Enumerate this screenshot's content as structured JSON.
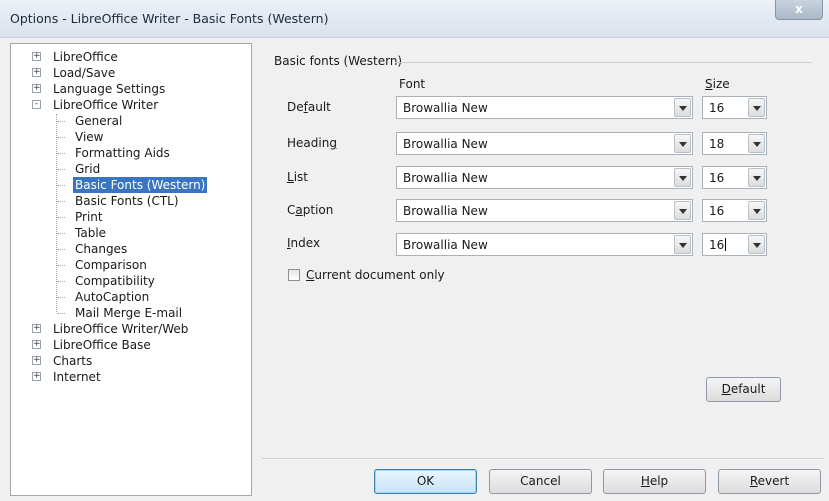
{
  "window": {
    "title": "Options - LibreOffice Writer - Basic Fonts (Western)",
    "close_label": "x"
  },
  "tree": {
    "items": [
      {
        "label": "LibreOffice",
        "level": 0,
        "expander": "+"
      },
      {
        "label": "Load/Save",
        "level": 0,
        "expander": "+"
      },
      {
        "label": "Language Settings",
        "level": 0,
        "expander": "+"
      },
      {
        "label": "LibreOffice Writer",
        "level": 0,
        "expander": "-"
      },
      {
        "label": "General",
        "level": 1
      },
      {
        "label": "View",
        "level": 1
      },
      {
        "label": "Formatting Aids",
        "level": 1
      },
      {
        "label": "Grid",
        "level": 1
      },
      {
        "label": "Basic Fonts (Western)",
        "level": 1,
        "selected": true
      },
      {
        "label": "Basic Fonts (CTL)",
        "level": 1
      },
      {
        "label": "Print",
        "level": 1
      },
      {
        "label": "Table",
        "level": 1
      },
      {
        "label": "Changes",
        "level": 1
      },
      {
        "label": "Comparison",
        "level": 1
      },
      {
        "label": "Compatibility",
        "level": 1
      },
      {
        "label": "AutoCaption",
        "level": 1
      },
      {
        "label": "Mail Merge E-mail",
        "level": 1
      },
      {
        "label": "LibreOffice Writer/Web",
        "level": 0,
        "expander": "+"
      },
      {
        "label": "LibreOffice Base",
        "level": 0,
        "expander": "+"
      },
      {
        "label": "Charts",
        "level": 0,
        "expander": "+"
      },
      {
        "label": "Internet",
        "level": 0,
        "expander": "+"
      }
    ]
  },
  "panel": {
    "group_title": "Basic fonts (Western)",
    "font_header": "Font",
    "size_header_pre": "",
    "size_header_ul": "S",
    "size_header_post": "ize",
    "rows": [
      {
        "label_pre": "De",
        "label_ul": "f",
        "label_post": "ault",
        "font": "Browallia New",
        "size": "16"
      },
      {
        "label_pre": "Headin",
        "label_ul": "g",
        "label_post": "",
        "font": "Browallia New",
        "size": "18"
      },
      {
        "label_pre": "",
        "label_ul": "L",
        "label_post": "ist",
        "font": "Browallia New",
        "size": "16"
      },
      {
        "label_pre": "C",
        "label_ul": "a",
        "label_post": "ption",
        "font": "Browallia New",
        "size": "16"
      },
      {
        "label_pre": "",
        "label_ul": "I",
        "label_post": "ndex",
        "font": "Browallia New",
        "size": "16"
      }
    ],
    "checkbox_pre": "",
    "checkbox_ul": "C",
    "checkbox_post": "urrent document only",
    "default_pre": "",
    "default_ul": "D",
    "default_post": "efault"
  },
  "buttons": {
    "ok": "OK",
    "cancel": "Cancel",
    "help_ul": "H",
    "help_post": "elp",
    "revert_ul": "R",
    "revert_post": "evert"
  }
}
